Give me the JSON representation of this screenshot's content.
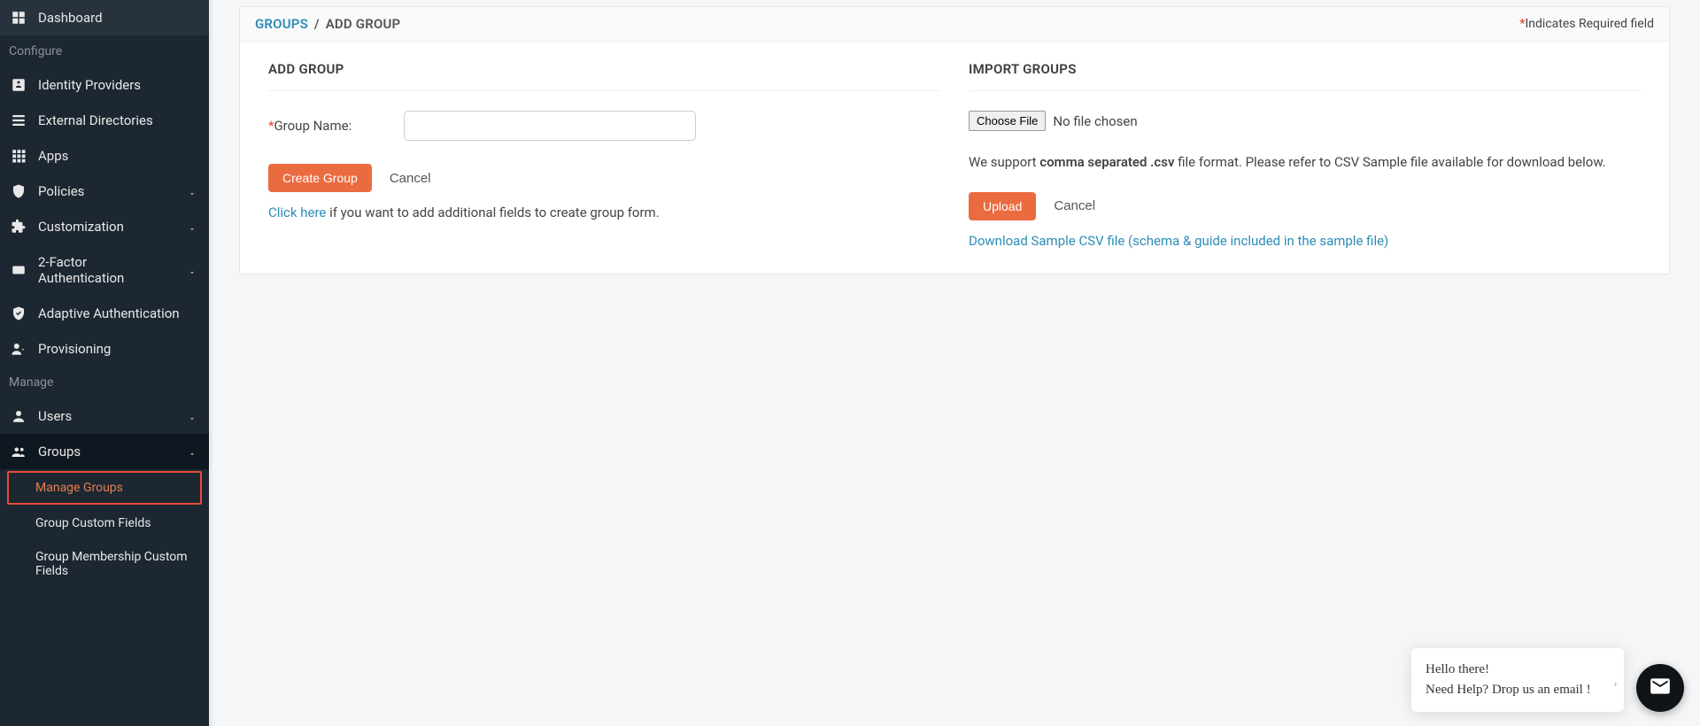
{
  "sidebar": {
    "dashboard": "Dashboard",
    "configure_header": "Configure",
    "identity_providers": "Identity Providers",
    "external_directories": "External Directories",
    "apps": "Apps",
    "policies": "Policies",
    "customization": "Customization",
    "two_factor": "2-Factor Authentication",
    "adaptive_auth": "Adaptive Authentication",
    "provisioning": "Provisioning",
    "manage_header": "Manage",
    "users": "Users",
    "groups": "Groups",
    "sub_manage_groups": "Manage Groups",
    "sub_group_custom_fields": "Group Custom Fields",
    "sub_group_membership": "Group Membership Custom Fields"
  },
  "breadcrumb": {
    "parent": "GROUPS",
    "sep": "/",
    "current": "ADD GROUP"
  },
  "required_note": "Indicates Required field",
  "left_panel": {
    "title": "ADD GROUP",
    "group_name_label": "Group Name:",
    "create_btn": "Create Group",
    "cancel": "Cancel",
    "click_here": "Click here",
    "hint_rest": " if you want to add additional fields to create group form."
  },
  "right_panel": {
    "title": "IMPORT GROUPS",
    "choose_file": "Choose File",
    "no_file": "No file chosen",
    "support_pre": "We support ",
    "support_bold": "comma separated .csv",
    "support_post": " file format. Please refer to CSV Sample file available for download below.",
    "upload": "Upload",
    "cancel": "Cancel",
    "download_link": "Download Sample CSV file (schema & guide included in the sample file)"
  },
  "chat": {
    "line1": "Hello there!",
    "line2": "Need Help? Drop us an email !"
  }
}
